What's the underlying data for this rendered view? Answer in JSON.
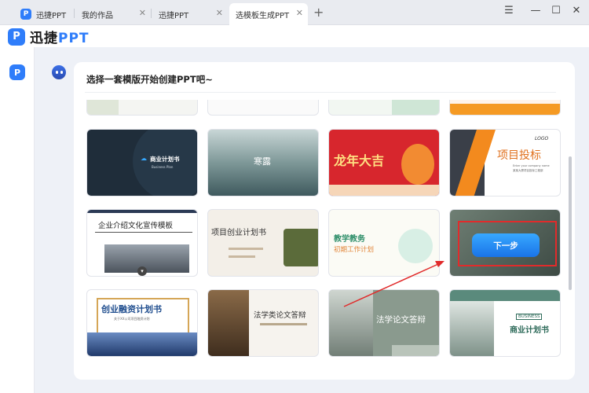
{
  "tabs": [
    {
      "label": "迅捷PPT",
      "icon": "app-logo-icon"
    },
    {
      "label": "我的作品",
      "close": "✕"
    },
    {
      "label": "迅捷PPT",
      "close": "✕"
    },
    {
      "label": "选模板生成PPT",
      "close": "✕",
      "active": true
    }
  ],
  "tabbar": {
    "new_tab": "+",
    "menu": "☰",
    "minimize": "—",
    "maximize": "☐",
    "close": "✕"
  },
  "brand": {
    "icon_letter": "P",
    "name": "迅捷",
    "name_suffix": "PPT"
  },
  "sidebar": {
    "icon_letter": "P"
  },
  "main": {
    "prompt": "选择一套模版开始创建PPT吧~"
  },
  "templates": {
    "commerce": {
      "title": "商业计划书",
      "sub": "Business Plan"
    },
    "hanlu": {
      "title": "寒露"
    },
    "dragon": {
      "title": "龙年大吉"
    },
    "bid": {
      "logo": "LOGO",
      "title": "项目投标",
      "line1": "Enter your company name",
      "line2": "某某大厦项目投标工程部"
    },
    "corp": {
      "title": "企业介绍文化宣传模板"
    },
    "startup": {
      "title": "项目创业计划书"
    },
    "teach": {
      "title1": "教学教务",
      "title2": "初期工作计划"
    },
    "next": {
      "button": "下一步"
    },
    "finance": {
      "title": "创业融资计划书",
      "sub": "关于XX公司项目融资计划"
    },
    "liberal": {
      "title": "法学类论文答辩"
    },
    "law": {
      "title": "法学论文答辩"
    },
    "business2": {
      "tag": "BUSINESS",
      "title": "商业计划书"
    }
  },
  "colors": {
    "accent": "#2f7dfa",
    "highlight": "#e12b2b"
  }
}
